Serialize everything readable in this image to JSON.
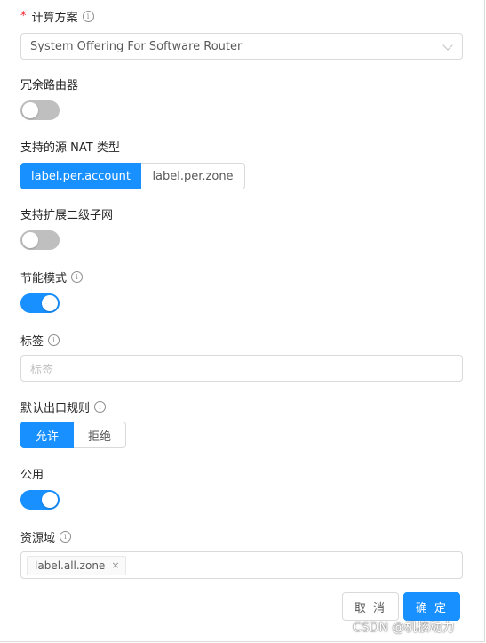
{
  "form": {
    "compute_offering": {
      "label": "计算方案",
      "required_mark": "*",
      "value": "System Offering For Software Router"
    },
    "redundant_router": {
      "label": "冗余路由器",
      "enabled": false
    },
    "source_nat_type": {
      "label": "支持的源 NAT 类型",
      "options": [
        "label.per.account",
        "label.per.zone"
      ],
      "selected": "label.per.account"
    },
    "distributed_subnet": {
      "label": "支持扩展二级子网",
      "enabled": false
    },
    "conserve_mode": {
      "label": "节能模式",
      "enabled": true
    },
    "tags": {
      "label": "标签",
      "placeholder": "标签"
    },
    "egress_policy": {
      "label": "默认出口规则",
      "options": [
        "允许",
        "拒绝"
      ],
      "selected": "允许"
    },
    "public": {
      "label": "公用",
      "enabled": true
    },
    "domain": {
      "label": "资源域",
      "tags": [
        "label.all.zone"
      ],
      "remove_glyph": "×"
    }
  },
  "footer": {
    "cancel_label": "取 消",
    "ok_label": "确 定"
  },
  "watermark": "CSDN @机核动力",
  "icons": {
    "info": "info-circle-icon",
    "chevron": "chevron-down-icon",
    "close": "close-icon"
  },
  "colors": {
    "primary": "#1890ff",
    "required": "#f5222d",
    "switch_off": "#bfbfbf"
  }
}
